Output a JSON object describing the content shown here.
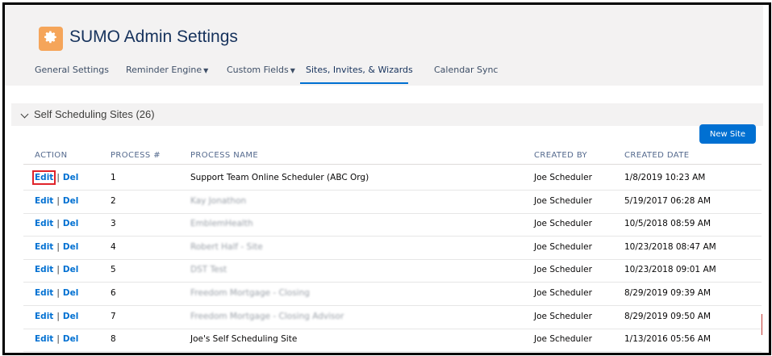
{
  "app": {
    "title": "SUMO Admin Settings",
    "logo_icon": "gear-icon"
  },
  "tabs": [
    {
      "label": "General Settings",
      "has_menu": false,
      "active": false
    },
    {
      "label": "Reminder Engine",
      "has_menu": true,
      "active": false
    },
    {
      "label": "Custom Fields",
      "has_menu": true,
      "active": false
    },
    {
      "label": "Sites, Invites, & Wizards",
      "has_menu": false,
      "active": true
    },
    {
      "label": "Calendar Sync",
      "has_menu": false,
      "active": false
    }
  ],
  "section": {
    "label": "Self Scheduling Sites (26)",
    "expanded": true
  },
  "new_site_button": "New Site",
  "table": {
    "headers": [
      "ACTION",
      "PROCESS #",
      "PROCESS NAME",
      "CREATED BY",
      "CREATED DATE"
    ],
    "edit_label": "Edit",
    "sep": "|",
    "del_label": "Del",
    "rows": [
      {
        "process": "1",
        "name": "Support Team Online Scheduler (ABC Org)",
        "name_blurred": false,
        "created_by": "Joe Scheduler",
        "created_date": "1/8/2019 10:23 AM",
        "highlight_edit": true
      },
      {
        "process": "2",
        "name": "Kay Jonathon",
        "name_blurred": true,
        "created_by": "Joe Scheduler",
        "created_date": "5/19/2017 06:28 AM",
        "highlight_edit": false
      },
      {
        "process": "3",
        "name": "EmblemHealth",
        "name_blurred": true,
        "created_by": "Joe Scheduler",
        "created_date": "10/5/2018 08:59 AM",
        "highlight_edit": false
      },
      {
        "process": "4",
        "name": "Robert Half - Site",
        "name_blurred": true,
        "created_by": "Joe Scheduler",
        "created_date": "10/23/2018 08:47 AM",
        "highlight_edit": false
      },
      {
        "process": "5",
        "name": "DST Test",
        "name_blurred": true,
        "created_by": "Joe Scheduler",
        "created_date": "10/23/2018 09:01 AM",
        "highlight_edit": false
      },
      {
        "process": "6",
        "name": "Freedom Mortgage - Closing",
        "name_blurred": true,
        "created_by": "Joe Scheduler",
        "created_date": "8/29/2019 09:39 AM",
        "highlight_edit": false
      },
      {
        "process": "7",
        "name": "Freedom Mortgage - Closing Advisor",
        "name_blurred": true,
        "created_by": "Joe Scheduler",
        "created_date": "8/29/2019 09:50 AM",
        "highlight_edit": false
      },
      {
        "process": "8",
        "name": "Joe's Self Scheduling Site",
        "name_blurred": false,
        "created_by": "Joe Scheduler",
        "created_date": "1/13/2016 05:56 AM",
        "highlight_edit": false
      }
    ]
  },
  "colors": {
    "accent": "#0070d2",
    "logo_bg": "#f5a55a",
    "highlight": "#e0242b"
  }
}
